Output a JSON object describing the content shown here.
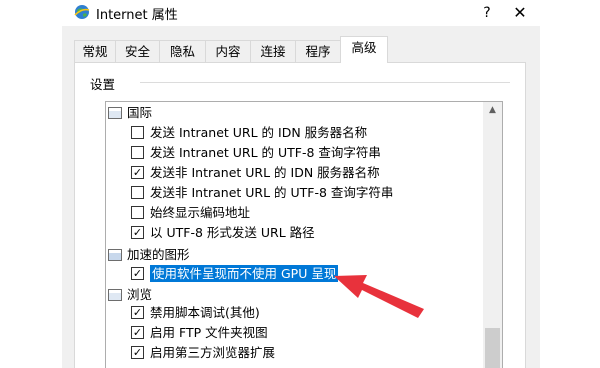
{
  "window": {
    "title": "Internet 属性",
    "help_glyph": "?",
    "close_glyph": "✕",
    "icon": "internet-globe-icon"
  },
  "tabs": [
    {
      "label": "常规",
      "active": false
    },
    {
      "label": "安全",
      "active": false
    },
    {
      "label": "隐私",
      "active": false
    },
    {
      "label": "内容",
      "active": false
    },
    {
      "label": "连接",
      "active": false
    },
    {
      "label": "程序",
      "active": false
    },
    {
      "label": "高级",
      "active": true
    }
  ],
  "settings": {
    "group_label": "设置",
    "categories": {
      "intl": {
        "label": "国际",
        "icon": "settings-category-icon"
      },
      "accel": {
        "label": "加速的图形",
        "icon": "graphics-category-icon"
      },
      "browse": {
        "label": "浏览",
        "icon": "settings-category-icon"
      }
    },
    "items": [
      {
        "label": "发送 Intranet URL 的 IDN 服务器名称",
        "checked": false,
        "mark": ""
      },
      {
        "label": "发送 Intranet URL 的 UTF-8 查询字符串",
        "checked": false,
        "mark": ""
      },
      {
        "label": "发送非 Intranet URL 的 IDN 服务器名称",
        "checked": true,
        "mark": "✓"
      },
      {
        "label": "发送非 Intranet URL 的 UTF-8 查询字符串",
        "checked": false,
        "mark": ""
      },
      {
        "label": "始终显示编码地址",
        "checked": false,
        "mark": ""
      },
      {
        "label": "以 UTF-8 形式发送 URL 路径",
        "checked": true,
        "mark": "✓"
      },
      {
        "label": "使用软件呈现而不使用 GPU 呈现",
        "checked": true,
        "mark": "✓",
        "selected": true
      },
      {
        "label": "禁用脚本调试(其他)",
        "checked": true,
        "mark": "✓"
      },
      {
        "label": "启用 FTP 文件夹视图",
        "checked": true,
        "mark": "✓"
      },
      {
        "label": "启用第三方浏览器扩展",
        "checked": true,
        "mark": "✓"
      }
    ]
  },
  "colors": {
    "selection": "#0078d7",
    "annotation_arrow": "#e8323c"
  }
}
